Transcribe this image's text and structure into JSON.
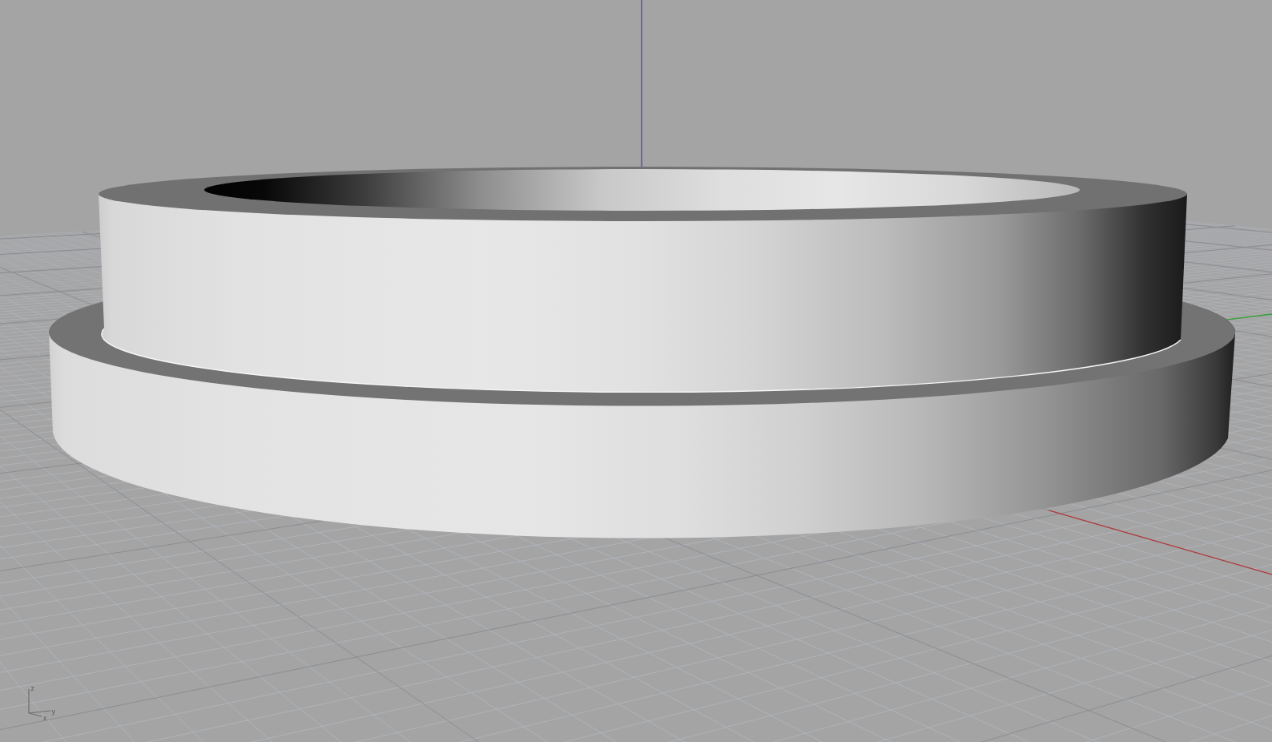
{
  "viewport": {
    "axis_triad": {
      "z_label": "z",
      "y_label": "y",
      "x_label": "x"
    }
  }
}
